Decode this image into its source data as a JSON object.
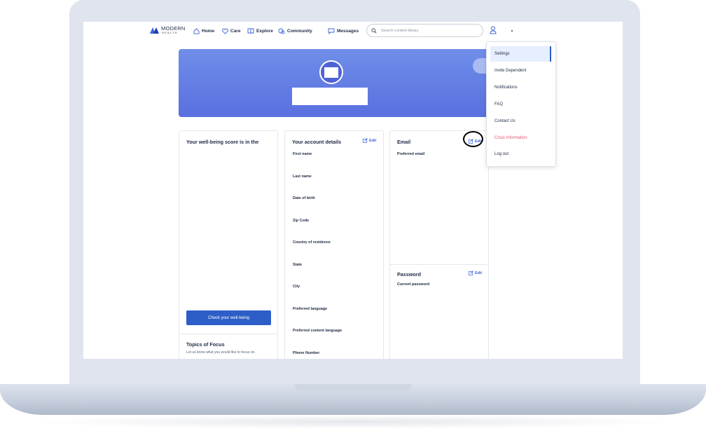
{
  "brand": {
    "name": "MODERN",
    "sub": "HEALTH"
  },
  "nav": {
    "items": [
      {
        "label": "Home",
        "icon": "home-icon"
      },
      {
        "label": "Care",
        "icon": "heart-icon"
      },
      {
        "label": "Explore",
        "icon": "book-icon"
      },
      {
        "label": "Community",
        "icon": "community-icon"
      },
      {
        "label": "Messages",
        "icon": "message-icon"
      }
    ],
    "search_placeholder": "Search content library"
  },
  "wellbeing": {
    "title": "Your well-being score is in the",
    "button": "Check your well-being",
    "topics_title": "Topics of Focus",
    "topics_sub": "Let us know what you would like to focus on."
  },
  "account": {
    "title": "Your account details",
    "edit": "Edit",
    "fields": [
      "First name",
      "Last name",
      "Date of birth",
      "Zip Code",
      "Country of residence",
      "State",
      "City",
      "Preferred language",
      "Preferred content language",
      "Phone Number"
    ]
  },
  "email": {
    "title": "Email",
    "edit": "Edit",
    "field": "Preferred email"
  },
  "password": {
    "title": "Password",
    "edit": "Edit",
    "field": "Current password"
  },
  "menu": {
    "items": [
      "Settings",
      "Invite Dependent",
      "Notifications",
      "FAQ",
      "Contact Us",
      "Crisis Information",
      "Log out"
    ],
    "selected": "Settings"
  },
  "colors": {
    "accent": "#2d5ec7",
    "banner": "#5a6fe0",
    "crisis": "#e05a72"
  }
}
